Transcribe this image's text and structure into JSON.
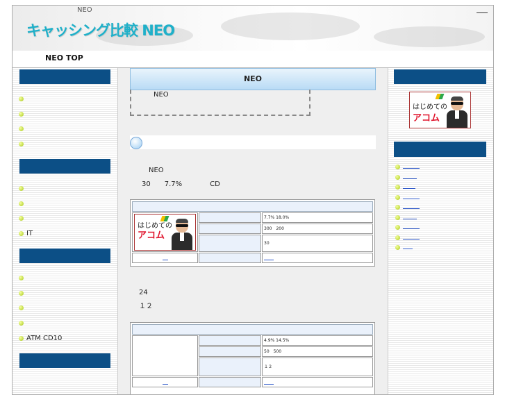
{
  "header": {
    "site_small": "NEO",
    "logo": "キャッシング比較 NEO"
  },
  "nav": {
    "top_link": "NEO TOP"
  },
  "left_sidebar": {
    "groups": [
      {
        "items": [
          "",
          "",
          "",
          ""
        ]
      },
      {
        "items": [
          "",
          "",
          "",
          "IT"
        ]
      },
      {
        "items": [
          "",
          "",
          "",
          "",
          "ATM CD10"
        ]
      }
    ]
  },
  "main": {
    "title": "NEO",
    "intro_text": "NEO",
    "para1": {
      "line1": "NEO",
      "line2": "30　　7.7%　　　　CD"
    },
    "table1": {
      "banner_line1": "はじめての",
      "banner_line2": "アコム",
      "values": [
        "7.7% 18.0%",
        "300　200",
        "30"
      ]
    },
    "para2": {
      "line1": "24",
      "line2": "１２"
    },
    "table2": {
      "values": [
        "4.9% 14.5%",
        "50　500",
        "１２"
      ]
    }
  },
  "right_sidebar": {
    "banner_line1": "はじめての",
    "banner_line2": "アコム",
    "list_count": 8
  }
}
